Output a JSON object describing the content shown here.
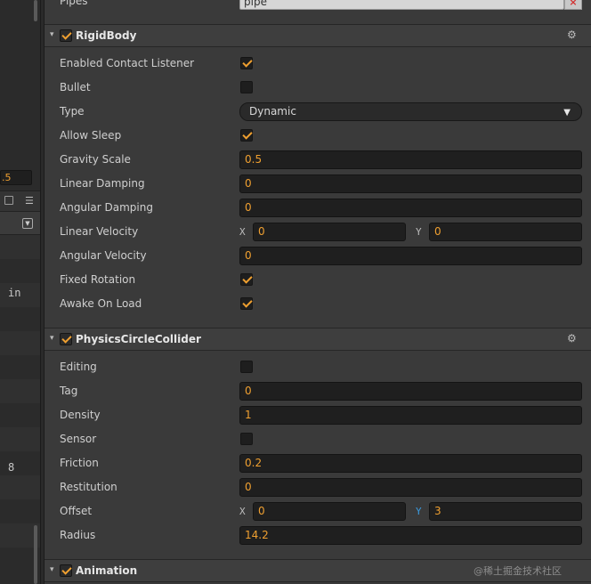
{
  "left_panel": {
    "field_value": ".5",
    "text_in": "in",
    "text_8": "8"
  },
  "top_row": {
    "label": "Pipes",
    "value": "pipe",
    "clear_glyph": "×"
  },
  "rigidbody": {
    "title": "RigidBody",
    "enabled": true,
    "props": {
      "enabled_contact_listener": {
        "label": "Enabled Contact Listener",
        "checked": true
      },
      "bullet": {
        "label": "Bullet",
        "checked": false
      },
      "type": {
        "label": "Type",
        "value": "Dynamic"
      },
      "allow_sleep": {
        "label": "Allow Sleep",
        "checked": true
      },
      "gravity_scale": {
        "label": "Gravity Scale",
        "value": "0.5"
      },
      "linear_damping": {
        "label": "Linear Damping",
        "value": "0"
      },
      "angular_damping": {
        "label": "Angular Damping",
        "value": "0"
      },
      "linear_velocity": {
        "label": "Linear Velocity",
        "x_label": "X",
        "x": "0",
        "y_label": "Y",
        "y": "0"
      },
      "angular_velocity": {
        "label": "Angular Velocity",
        "value": "0"
      },
      "fixed_rotation": {
        "label": "Fixed Rotation",
        "checked": true
      },
      "awake_on_load": {
        "label": "Awake On Load",
        "checked": true
      }
    }
  },
  "circle_collider": {
    "title": "PhysicsCircleCollider",
    "enabled": true,
    "props": {
      "editing": {
        "label": "Editing",
        "checked": false
      },
      "tag": {
        "label": "Tag",
        "value": "0"
      },
      "density": {
        "label": "Density",
        "value": "1"
      },
      "sensor": {
        "label": "Sensor",
        "checked": false
      },
      "friction": {
        "label": "Friction",
        "value": "0.2"
      },
      "restitution": {
        "label": "Restitution",
        "value": "0"
      },
      "offset": {
        "label": "Offset",
        "x_label": "X",
        "x": "0",
        "y_label": "Y",
        "y": "3"
      },
      "radius": {
        "label": "Radius",
        "value": "14.2"
      }
    }
  },
  "animation": {
    "title": "Animation",
    "enabled": true
  },
  "icons": {
    "collapse": "▾",
    "gear": "⚙",
    "caret": "▼"
  },
  "watermark": "@稀土掘金技术社区",
  "colors": {
    "accent": "#f0a030",
    "y_highlight": "#3a9be0",
    "background": "#3a3a3a"
  }
}
